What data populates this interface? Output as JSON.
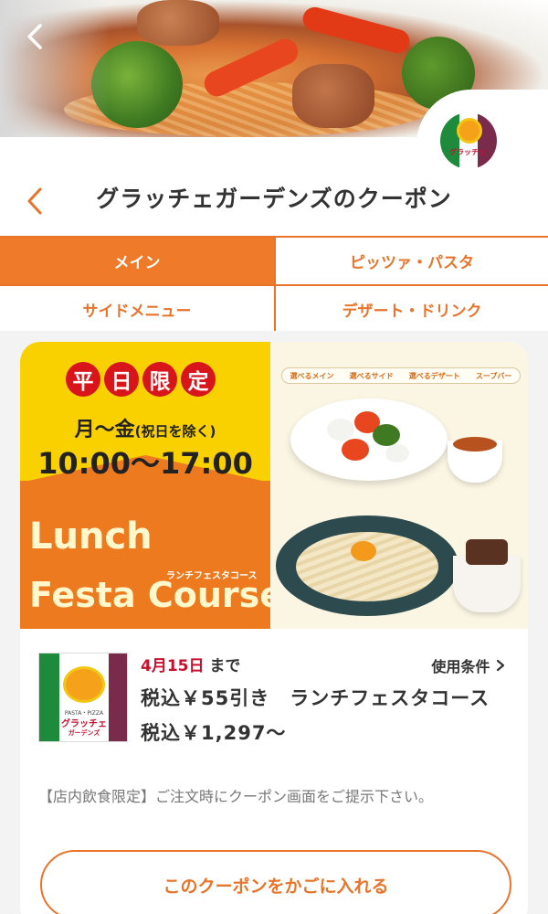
{
  "hero": {
    "back_icon": "chevron-left-icon"
  },
  "header": {
    "title": "グラッチェガーデンズのクーポン",
    "back_icon": "chevron-left-icon"
  },
  "tabs": [
    {
      "label": "メイン",
      "active": true
    },
    {
      "label": "ピッツァ・パスタ",
      "active": false
    },
    {
      "label": "サイドメニュー",
      "active": false
    },
    {
      "label": "デザート・ドリンク",
      "active": false
    }
  ],
  "banner": {
    "weekday_chars": [
      "平",
      "日",
      "限",
      "定"
    ],
    "days": "月〜金",
    "days_note": "(祝日を除く)",
    "hours": "10:00〜17:00",
    "course_line1": "Lunch",
    "course_line2": "Festa Course",
    "course_kana": "ランチフェスタコース",
    "course_items": [
      "選べるメイン",
      "選べるサイド",
      "選べるデザート",
      "スープバー"
    ]
  },
  "coupon": {
    "deadline_date": "4月15日",
    "deadline_suffix": "まで",
    "conditions_label": "使用条件",
    "title": "税込￥55引き　ランチフェスタコース",
    "price": "税込￥1,297〜",
    "note": "【店内飲食限定】ご注文時にクーポン画面をご提示下さい。",
    "add_button": "このクーポンをかごに入れる",
    "logo_text": "グラッチェ",
    "logo_sub": "ガーデンズ",
    "logo_tagline": "PASTA・PIZZA"
  },
  "colors": {
    "accent": "#ee7a2a",
    "brand_green": "#1e8a3c",
    "brand_purple": "#7a2a4a",
    "deadline_red": "#c8102e"
  }
}
